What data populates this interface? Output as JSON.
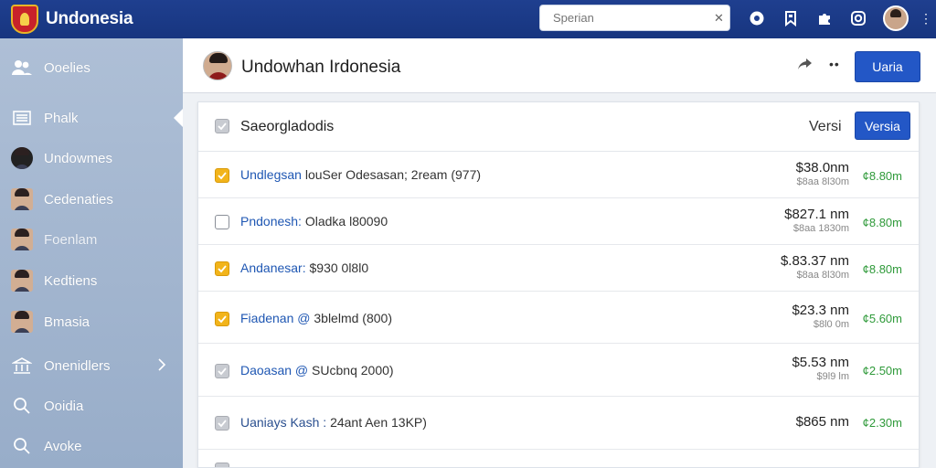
{
  "app": {
    "title": "Undonesia"
  },
  "search": {
    "placeholder": "Sperian",
    "clear": "✕"
  },
  "sidebar": {
    "items": [
      {
        "label": "Ooelies",
        "icon": "users-icon"
      },
      {
        "label": "Phalk",
        "icon": "list-icon"
      },
      {
        "label": "Undowmes",
        "icon": "avatar"
      },
      {
        "label": "Cedenaties",
        "icon": "avatar"
      },
      {
        "label": "Foenlam",
        "icon": "avatar"
      },
      {
        "label": "Kedtiens",
        "icon": "avatar"
      },
      {
        "label": "Bmasia",
        "icon": "avatar"
      },
      {
        "label": "Onenidlers",
        "icon": "bank-icon"
      },
      {
        "label": "Ooidia",
        "icon": "search-icon"
      },
      {
        "label": "Avoke",
        "icon": "search-icon"
      }
    ]
  },
  "header": {
    "title": "Undowhan Irdonesia",
    "button_label": "Uaria",
    "more": "••"
  },
  "card": {
    "title": "Saeorgladodis",
    "versi_label": "Versi",
    "versi_button": "Versia"
  },
  "rows": [
    {
      "name": "Undlegsan",
      "detail": "louSer Odesasan; 2ream (977)",
      "price": "$38.0nm",
      "sub": "$8aa 8l30m",
      "delta": "¢8.80m",
      "check": "yellow"
    },
    {
      "name": "Pndonesh:",
      "detail": "Oladka l80090",
      "price": "$827.1 nm",
      "sub": "$8aa 1830m",
      "delta": "¢8.80m",
      "check": "empty"
    },
    {
      "name": "Andanesar:",
      "detail": "$930 0l8l0",
      "price": "$.83.37 nm",
      "sub": "$8aa 8l30m",
      "delta": "¢8.80m",
      "check": "yellow"
    },
    {
      "name": "Fiadenan @",
      "detail": "3blelmd (800)",
      "price": "$23.3 nm",
      "sub": "$8l0 0m",
      "delta": "¢5.60m",
      "check": "yellow"
    },
    {
      "name": "Daoasan @",
      "detail": "SUcbnq 2000)",
      "price": "$5.53 nm",
      "sub": "$9l9 lm",
      "delta": "¢2.50m",
      "check": "grey"
    },
    {
      "name": "Uaniays Kash :",
      "detail": "24ant Aen 13KP)",
      "price": "$865 nm",
      "sub": "",
      "delta": "¢2.30m",
      "check": "grey"
    }
  ],
  "colors": {
    "topbar": "#1f3f8f",
    "accent": "#2357c6",
    "positive": "#2f9a3a",
    "check_yellow": "#f2b41b"
  }
}
